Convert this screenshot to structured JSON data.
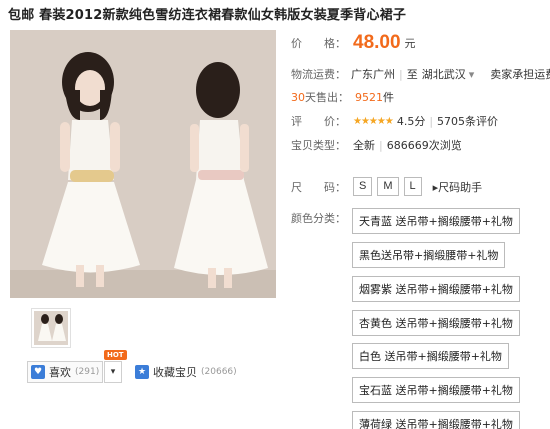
{
  "product": {
    "title": "包邮 春装2012新款纯色雪纺连衣裙春款仙女韩版女装夏季背心裙子"
  },
  "price": {
    "label": "价　　格：",
    "value": "48.00",
    "unit": "元"
  },
  "shipping": {
    "label": "物流运费：",
    "from": "广东广州",
    "to_prefix": "至",
    "to": "湖北武汉",
    "dropdown": "▾",
    "fee": "卖家承担运费"
  },
  "sales": {
    "label_days": "30",
    "label_text": "天售出：",
    "count": "9521",
    "unit": "件"
  },
  "rating": {
    "label": "评　　价：",
    "score": "4.5分",
    "reviews": "5705条评价"
  },
  "type": {
    "label": "宝贝类型：",
    "value": "全新",
    "views": "686669次浏览"
  },
  "size": {
    "label": "尺　　码：",
    "options": [
      "S",
      "M",
      "L"
    ],
    "helper": "尺码助手"
  },
  "colors": {
    "label": "颜色分类：",
    "options": [
      "天青蓝 送吊带+搁缎腰带+礼物",
      "黑色送吊带+搁缎腰带+礼物",
      "烟雾紫 送吊带+搁缎腰带+礼物",
      "杏黄色 送吊带+搁缎腰带+礼物",
      "白色 送吊带+搁缎腰带+礼物",
      "宝石蓝 送吊带+搁缎腰带+礼物",
      "薄荷绿 送吊带+搁缎腰带+礼物"
    ]
  },
  "actions": {
    "hot": "HOT",
    "like_label": "喜欢",
    "like_count": "(291)",
    "fav_label": "收藏宝贝",
    "fav_count": "(20666)"
  },
  "icons": {
    "like": "heart-icon",
    "fav": "favorite-icon",
    "dropdown": "chevron-down-icon",
    "size_helper": "triangle-right-icon"
  },
  "accent_color": "#f26a1b"
}
